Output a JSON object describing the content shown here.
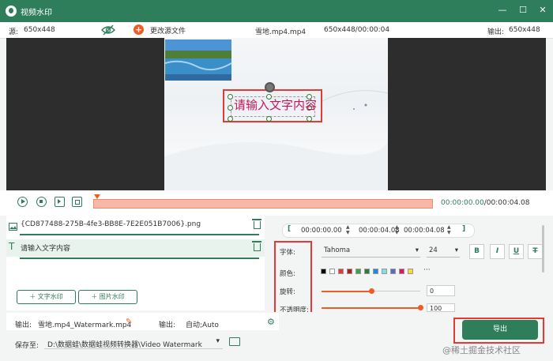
{
  "titlebar": {
    "title": "视频水印",
    "controls": [
      "minimize",
      "maximize",
      "close"
    ]
  },
  "infobar": {
    "source_label": "源:",
    "source_res": "650x448",
    "change_source": "更改源文件",
    "filename": "雪地.mp4.mp4",
    "res_time": "650x448/00:00:04",
    "output_label": "输出:",
    "output_res": "650x448"
  },
  "preview": {
    "watermark_text": "请输入文字内容"
  },
  "timeline": {
    "timecode": "00:00:00.00/00:00:04.08",
    "position_fraction": 0.0
  },
  "watermarks": {
    "items": [
      {
        "label": "{CD877488-275B-4fe3-BB8E-7E2E051B7006}.png",
        "icon": "image-icon"
      },
      {
        "label": "请输入文字内容",
        "icon": "text-icon"
      }
    ],
    "add_text": "文字水印",
    "add_image": "图片水印"
  },
  "settings": {
    "start_time": "00:00:00.00",
    "duration": "00:00:04.08",
    "end_time": "00:00:04.08",
    "font_label": "字体:",
    "font_value": "Tahoma",
    "size_value": "24",
    "color_label": "颜色:",
    "rotation_label": "旋转:",
    "rotation_value": "0",
    "opacity_label": "不透明度:",
    "opacity_value": "100",
    "more_colors": "···",
    "swatches": [
      "#000000",
      "#ffffff",
      "#e53935",
      "#b71c1c",
      "#43a047",
      "#2e7d32",
      "#1e88e5",
      "#80deea",
      "#5c6bc0",
      "#d81b60",
      "#fdd835"
    ]
  },
  "bottom": {
    "output_label": "输出:",
    "output_file": "雪地.mp4_Watermark.mp4",
    "output_format_label": "输出:",
    "output_format": "自动;Auto",
    "save_label": "保存至:",
    "save_path": "D:\\数据蛙\\数据蛙视频转换器\\Video Watermark",
    "export": "导出"
  },
  "footer_watermark": "@稀土掘金技术社区"
}
